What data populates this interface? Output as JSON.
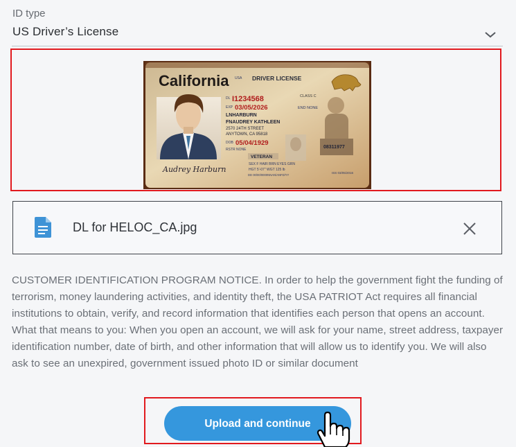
{
  "id_field": {
    "label": "ID type",
    "value": "US Driver’s License",
    "dropdown_icon": "chevron-down-icon"
  },
  "license": {
    "state": "California",
    "doc_type": "DRIVER LICENSE",
    "class": "CLASS C",
    "dl_prefix": "DL",
    "dl_number": "I1234568",
    "exp_prefix": "EXP",
    "exp_date": "03/05/2026",
    "end": "END NONE",
    "last_name": "LNHARBURN",
    "first_name": "FNAUDREY KATHLEEN",
    "address1": "2570 24TH STREET",
    "address2": "ANYTOWN, CA 95818",
    "dob_prefix": "DOB",
    "dob": "05/04/1929",
    "rstr": "RSTR NONE",
    "veteran": "VETERAN",
    "doc_code": "08311977",
    "stats": "SEX F  HAIR BRN  EYES GRN",
    "stats2": "HGT 5'-07\"  WGT 125 lb",
    "dd": "DD 00/00/0000NNAN/ANFD/YY",
    "iss": "ISS 03/05/2016",
    "signature": "Audrey Harburn"
  },
  "file": {
    "icon": "document-icon",
    "name": "DL for HELOC_CA.jpg",
    "remove_icon": "close-icon"
  },
  "notice": "CUSTOMER IDENTIFICATION PROGRAM NOTICE. In order to help the government fight the funding of terrorism, money laundering activities, and identity theft, the USA PATRIOT Act requires all financial institutions to obtain, verify, and record information that identifies each person that opens an account. What that means to you: When you open an account, we will ask for your name, street address, taxpayer identification number, date of birth, and other information that will allow us to identify you. We will also ask to see an unexpired, government issued photo ID or similar document",
  "cta": {
    "label": "Upload and continue"
  },
  "colors": {
    "accent": "#3597dd",
    "highlight": "#e1191e"
  }
}
